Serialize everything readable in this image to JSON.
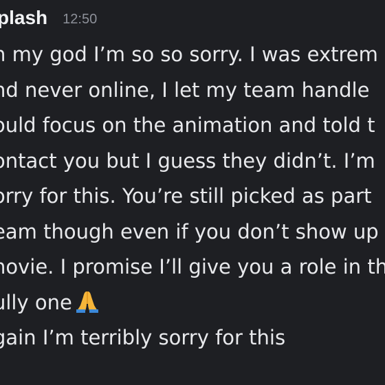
{
  "message": {
    "username": "plash",
    "timestamp": "12:50",
    "lines": [
      "h my god I’m so so sorry. I was extrem",
      "nd never online, I let my team handle",
      "ould focus on the animation and told t",
      "ontact you but I guess they didn’t. I’m",
      "orry for this. You’re still picked as part",
      "eam though even if you don’t show up",
      "novie. I promise I’ll give you a role in th",
      "ully one",
      "gain I’m terribly sorry for this"
    ],
    "emoji": "folded-hands-icon"
  }
}
